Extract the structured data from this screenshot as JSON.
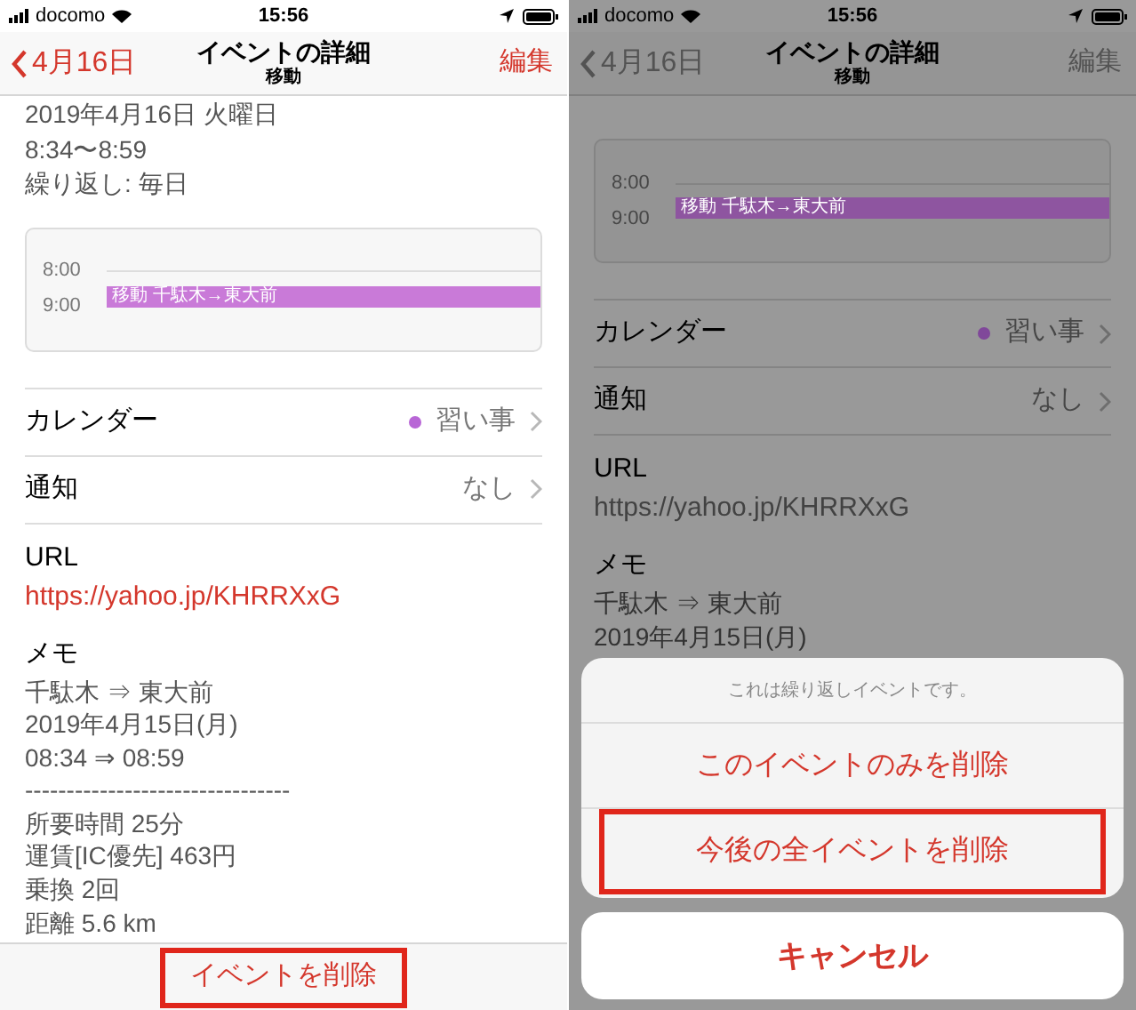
{
  "screens": [
    {
      "dimmed": false,
      "status_bar": {
        "carrier": "docomo",
        "time": "15:56"
      },
      "nav": {
        "back": "4月16日",
        "title": "イベントの詳細",
        "subtitle": "移動",
        "edit": "編集"
      },
      "header_lines": [
        "2019年4月16日 火曜日",
        "8:34〜8:59",
        "繰り返し: 毎日"
      ],
      "day_preview": {
        "hours": [
          "8:00",
          "9:00"
        ],
        "event": {
          "label": "移動 千駄木→東大前",
          "color": "#c97ad8"
        }
      },
      "rows": [
        {
          "label": "カレンダー",
          "value": "習い事",
          "color": "#b866d6"
        },
        {
          "label": "通知",
          "value": "なし"
        }
      ],
      "url": {
        "label": "URL",
        "link": "https://yahoo.jp/KHRRXxG"
      },
      "memo": {
        "label": "メモ",
        "lines": [
          "千駄木 ⇒ 東大前",
          "2019年4月15日(月)",
          "08:34 ⇒ 08:59",
          "--------------------------------",
          "所要時間 25分",
          "運賃[IC優先] 463円",
          "乗換 2回",
          "距離 5.6 km"
        ]
      },
      "delete_button": {
        "label": "イベントを削除",
        "highlighted": true
      }
    },
    {
      "dimmed": true,
      "status_bar": {
        "carrier": "docomo",
        "time": "15:56"
      },
      "nav": {
        "back": "4月16日",
        "title": "イベントの詳細",
        "subtitle": "移動",
        "edit": "編集"
      },
      "day_preview": {
        "hours": [
          "8:00",
          "9:00"
        ],
        "event": {
          "label": "移動 千駄木→東大前",
          "color": "#8e55a0"
        }
      },
      "rows": [
        {
          "label": "カレンダー",
          "value": "習い事",
          "color": "#80489a"
        },
        {
          "label": "通知",
          "value": "なし"
        }
      ],
      "url": {
        "label": "URL",
        "link": "https://yahoo.jp/KHRRXxG"
      },
      "memo": {
        "label": "メモ",
        "lines": [
          "千駄木 ⇒ 東大前",
          "2019年4月15日(月)"
        ]
      },
      "action_sheet": {
        "title": "これは繰り返しイベントです。",
        "actions": [
          {
            "label": "このイベントのみを削除",
            "highlighted": false
          },
          {
            "label": "今後の全イベントを削除",
            "highlighted": true
          }
        ],
        "cancel": "キャンセル"
      }
    }
  ]
}
